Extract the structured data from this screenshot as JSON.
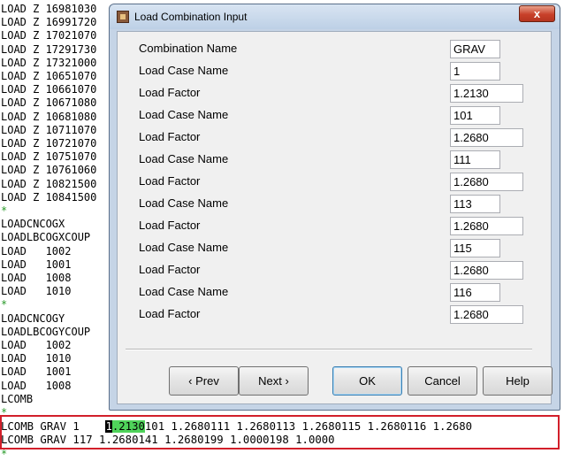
{
  "editor": {
    "lines": [
      {
        "text": "LOAD Z 16981030",
        "green": false
      },
      {
        "text": "LOAD Z 16991720",
        "green": false
      },
      {
        "text": "LOAD Z 17021070",
        "green": false
      },
      {
        "text": "LOAD Z 17291730",
        "green": false
      },
      {
        "text": "LOAD Z 17321000",
        "green": false
      },
      {
        "text": "LOAD Z 10651070",
        "green": false
      },
      {
        "text": "LOAD Z 10661070",
        "green": false
      },
      {
        "text": "LOAD Z 10671080",
        "green": false
      },
      {
        "text": "LOAD Z 10681080",
        "green": false
      },
      {
        "text": "LOAD Z 10711070",
        "green": false
      },
      {
        "text": "LOAD Z 10721070",
        "green": false
      },
      {
        "text": "LOAD Z 10751070",
        "green": false
      },
      {
        "text": "LOAD Z 10761060",
        "green": false
      },
      {
        "text": "LOAD Z 10821500",
        "green": false
      },
      {
        "text": "LOAD Z 10841500",
        "green": false
      },
      {
        "text": "*",
        "green": true
      },
      {
        "text": "LOADCNCOGX",
        "green": false
      },
      {
        "text": "LOADLBCOGXCOUP",
        "green": false
      },
      {
        "text": "LOAD   1002",
        "green": false
      },
      {
        "text": "LOAD   1001",
        "green": false
      },
      {
        "text": "LOAD   1008",
        "green": false
      },
      {
        "text": "LOAD   1010",
        "green": false
      },
      {
        "text": "*",
        "green": true
      },
      {
        "text": "LOADCNCOGY",
        "green": false
      },
      {
        "text": "LOADLBCOGYCOUP",
        "green": false
      },
      {
        "text": "LOAD   1002",
        "green": false
      },
      {
        "text": "LOAD   1010",
        "green": false
      },
      {
        "text": "LOAD   1001",
        "green": false
      },
      {
        "text": "LOAD   1008",
        "green": false
      },
      {
        "text": "LCOMB",
        "green": false
      },
      {
        "text": "*",
        "green": true
      }
    ],
    "lcomb1": {
      "prefix": "LCOMB GRAV 1    ",
      "cursor_char": "1",
      "selected": ".2130",
      "rest": "101 1.2680111 1.2680113 1.2680115 1.2680116 1.2680"
    },
    "lcomb2": "LCOMB GRAV 117 1.2680141 1.2680199 1.0000198 1.0000",
    "last_marker": "*",
    "colors": {
      "comment": "#2a9a2a",
      "highlight_box": "#d21f2a",
      "selection": "#4fd35a"
    }
  },
  "dialog": {
    "title": "Load Combination Input",
    "close_label": "x",
    "rows": [
      {
        "label": "Combination Name",
        "value": "GRAV",
        "short": true
      },
      {
        "label": "Load Case Name",
        "value": "1",
        "short": true
      },
      {
        "label": "Load Factor",
        "value": "1.2130",
        "short": false
      },
      {
        "label": "Load Case Name",
        "value": "101",
        "short": true
      },
      {
        "label": "Load Factor",
        "value": "1.2680",
        "short": false
      },
      {
        "label": "Load Case Name",
        "value": "111",
        "short": true
      },
      {
        "label": "Load Factor",
        "value": "1.2680",
        "short": false
      },
      {
        "label": "Load Case Name",
        "value": "113",
        "short": true
      },
      {
        "label": "Load Factor",
        "value": "1.2680",
        "short": false
      },
      {
        "label": "Load Case Name",
        "value": "115",
        "short": true
      },
      {
        "label": "Load Factor",
        "value": "1.2680",
        "short": false
      },
      {
        "label": "Load Case Name",
        "value": "116",
        "short": true
      },
      {
        "label": "Load Factor",
        "value": "1.2680",
        "short": false
      }
    ],
    "buttons": {
      "prev": "‹ Prev",
      "next": "Next ›",
      "ok": "OK",
      "cancel": "Cancel",
      "help": "Help"
    }
  }
}
